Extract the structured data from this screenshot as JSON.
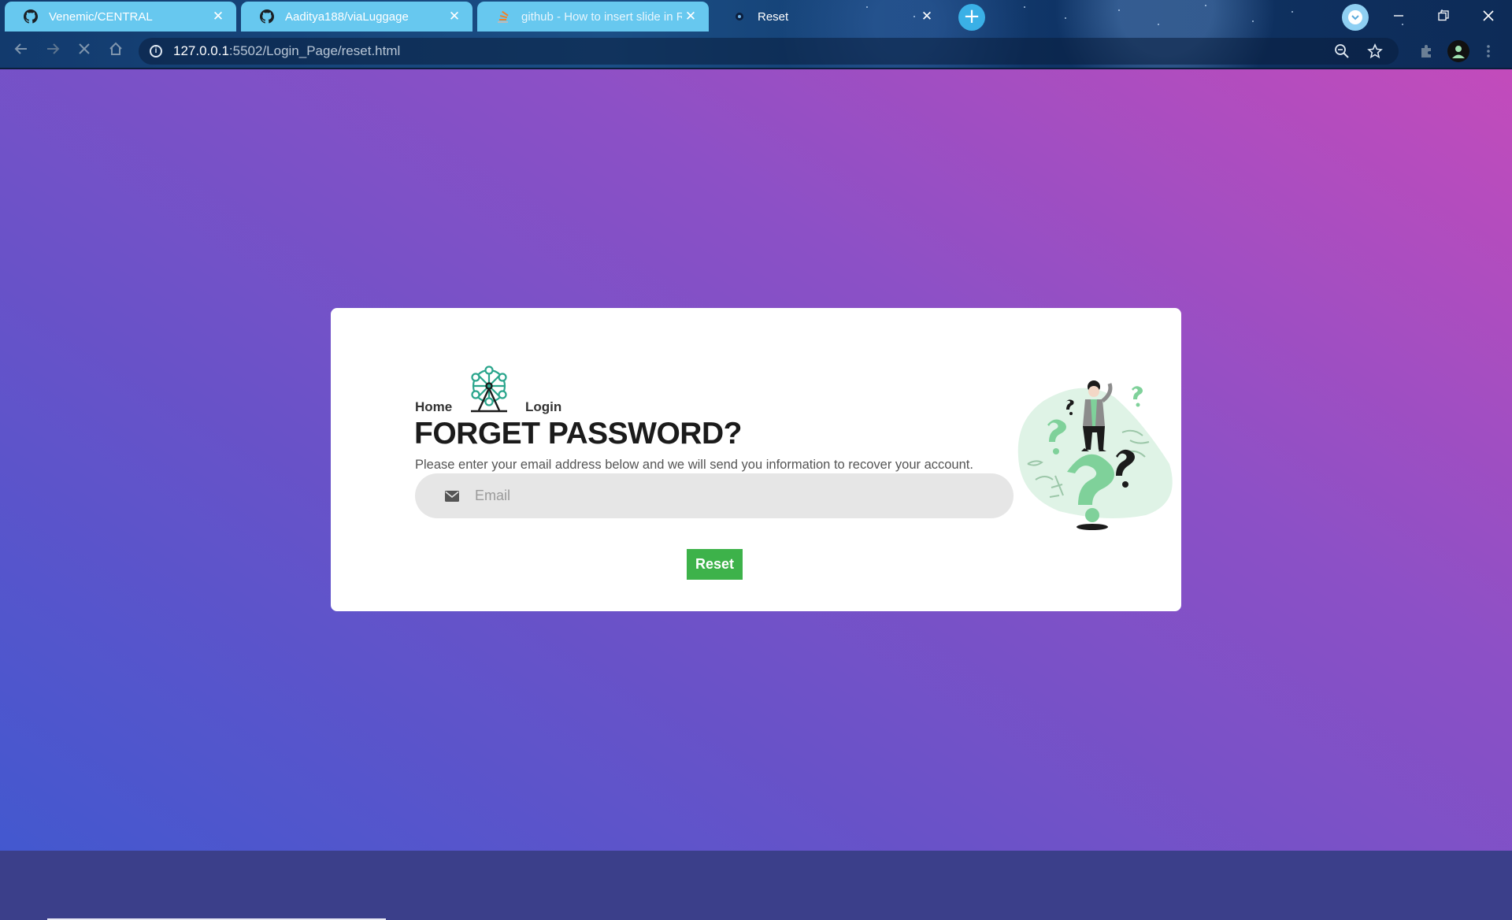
{
  "browser": {
    "tabs": [
      {
        "title": "Venemic/CENTRAL",
        "icon": "github-icon",
        "active": false
      },
      {
        "title": "Aaditya188/viaLuggage",
        "icon": "github-icon",
        "active": false
      },
      {
        "title": "github - How to insert slide in RE",
        "icon": "stackoverflow-icon",
        "active": false
      },
      {
        "title": "Reset",
        "icon": "page-favicon-icon",
        "active": true
      }
    ],
    "close_glyph": "✕",
    "new_tab_glyph": "+",
    "url_host": "127.0.0.1",
    "url_rest": ":5502/Login_Page/reset.html"
  },
  "page": {
    "nav": {
      "home": "Home",
      "login": "Login"
    },
    "title": "FORGET PASSWORD?",
    "subtitle": "Please enter your email address below and we will send you information to recover your account.",
    "email_placeholder": "Email",
    "reset_label": "Reset"
  },
  "colors": {
    "accent_green": "#3db24a",
    "logo_teal": "#2aa58c",
    "illustration_green": "#7fd19a"
  }
}
